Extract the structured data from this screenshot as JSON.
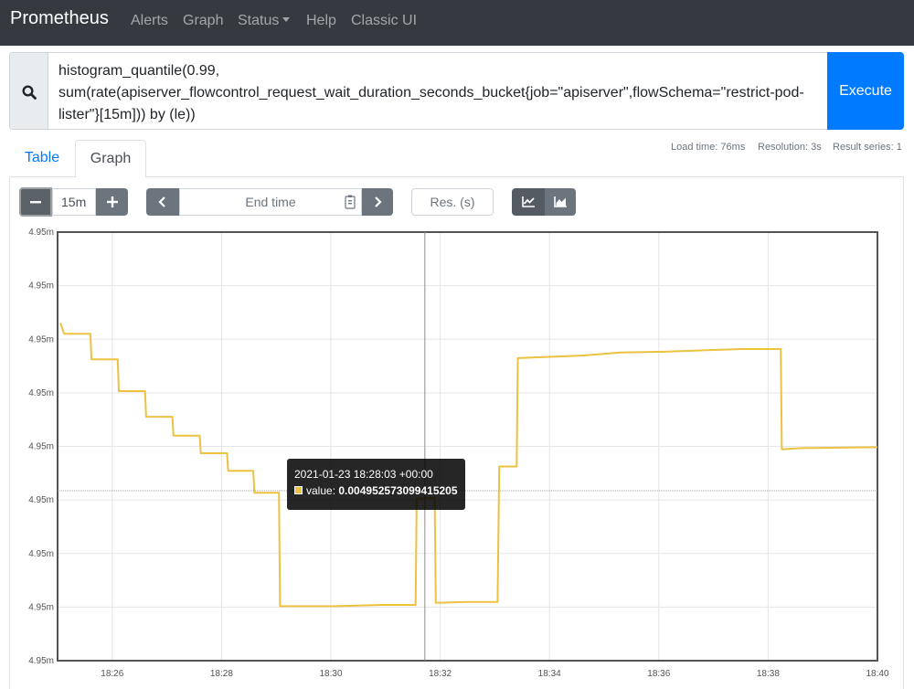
{
  "navbar": {
    "brand": "Prometheus",
    "links": [
      "Alerts",
      "Graph",
      "Status",
      "Help",
      "Classic UI"
    ]
  },
  "query": {
    "text": "histogram_quantile(0.99,\nsum(rate(apiserver_flowcontrol_request_wait_duration_seconds_bucket{job=\"apiserver\",flowSchema=\"restrict-pod-\nlister\"}[15m])) by (le))",
    "execute_label": "Execute"
  },
  "stats": {
    "load_time": "Load time: 76ms",
    "resolution": "Resolution: 3s",
    "result_series": "Result series: 1"
  },
  "tabs": {
    "table": "Table",
    "graph": "Graph"
  },
  "controls": {
    "range_value": "15m",
    "end_time_placeholder": "End time",
    "resolution_placeholder": "Res. (s)"
  },
  "tooltip": {
    "time": "2021-01-23 18:28:03 +00:00",
    "value_label": "value:",
    "value": "0.004952573099415205"
  },
  "colors": {
    "series": "#edc240",
    "navbar": "#343a40",
    "execute": "#007bff"
  },
  "chart_data": {
    "type": "line",
    "y_tick_labels": [
      "4.95m",
      "4.95m",
      "4.95m",
      "4.95m",
      "4.95m",
      "4.95m",
      "4.95m",
      "4.95m",
      "4.95m"
    ],
    "x_tick_labels": [
      "18:26",
      "18:28",
      "18:30",
      "18:32",
      "18:34",
      "18:36",
      "18:38",
      "18:40"
    ],
    "x_range_minutes": [
      1105.1,
      1120.0
    ],
    "y_range_rel": [
      0,
      1
    ],
    "grid": true,
    "cursor_x": 1111.72,
    "series": [
      {
        "points": [
          [
            1105.05,
            0.788
          ],
          [
            1105.12,
            0.763
          ],
          [
            1105.6,
            0.763
          ],
          [
            1105.62,
            0.703
          ],
          [
            1106.1,
            0.703
          ],
          [
            1106.12,
            0.629
          ],
          [
            1106.6,
            0.629
          ],
          [
            1106.62,
            0.569
          ],
          [
            1107.1,
            0.569
          ],
          [
            1107.12,
            0.525
          ],
          [
            1107.6,
            0.525
          ],
          [
            1107.62,
            0.484
          ],
          [
            1108.1,
            0.484
          ],
          [
            1108.12,
            0.443
          ],
          [
            1108.58,
            0.443
          ],
          [
            1108.6,
            0.392
          ],
          [
            1109.05,
            0.392
          ],
          [
            1109.07,
            0.127
          ],
          [
            1110.1,
            0.127
          ],
          [
            1110.92,
            0.13
          ],
          [
            1111.55,
            0.13
          ],
          [
            1111.57,
            0.378
          ],
          [
            1111.9,
            0.38
          ],
          [
            1111.92,
            0.135
          ],
          [
            1112.5,
            0.137
          ],
          [
            1113.05,
            0.137
          ],
          [
            1113.08,
            0.453
          ],
          [
            1113.4,
            0.453
          ],
          [
            1113.42,
            0.706
          ],
          [
            1114.6,
            0.712
          ],
          [
            1115.3,
            0.719
          ],
          [
            1116.1,
            0.721
          ],
          [
            1117.5,
            0.727
          ],
          [
            1118.23,
            0.727
          ],
          [
            1118.25,
            0.493
          ],
          [
            1118.6,
            0.496
          ],
          [
            1120.0,
            0.498
          ]
        ]
      }
    ]
  }
}
